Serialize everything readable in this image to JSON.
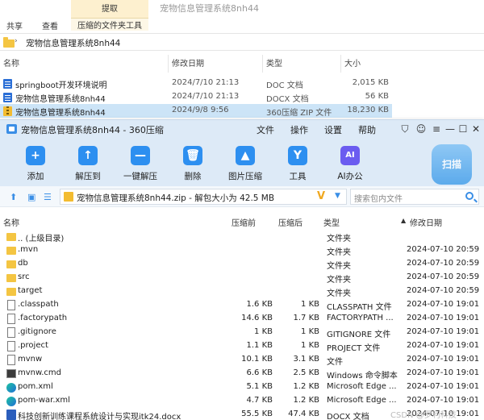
{
  "explorer": {
    "tabs": [
      "共享",
      "查看"
    ],
    "tool_group_title": "提取",
    "tool_group_tab": "压缩的文件夹工具",
    "window_title": "宠物信息管理系统8nh44",
    "address": "宠物信息管理系统8nh44",
    "columns": [
      "名称",
      "修改日期",
      "类型",
      "大小"
    ],
    "files": [
      {
        "name": "springboot开发环境说明",
        "date": "2024/7/10 21:13",
        "type": "DOC 文档",
        "size": "2,015 KB",
        "icon": "doc-icon",
        "selected": false
      },
      {
        "name": "宠物信息管理系统8nh44",
        "date": "2024/7/10 21:13",
        "type": "DOCX 文档",
        "size": "56 KB",
        "icon": "doc-icon",
        "selected": false
      },
      {
        "name": "宠物信息管理系统8nh44",
        "date": "2024/9/8 9:56",
        "type": "360压缩 ZIP 文件",
        "size": "18,230 KB",
        "icon": "zip-icon",
        "selected": true
      }
    ]
  },
  "app": {
    "title": "宠物信息管理系统8nh44 - 360压缩",
    "menu": [
      "文件",
      "操作",
      "设置",
      "帮助"
    ],
    "toolbar": [
      {
        "label": "添加",
        "icon": "add-icon",
        "glyph": "+"
      },
      {
        "label": "解压到",
        "icon": "extract-to-icon",
        "glyph": "↑"
      },
      {
        "label": "一键解压",
        "icon": "one-click-extract-icon",
        "glyph": "—"
      },
      {
        "label": "删除",
        "icon": "delete-icon",
        "glyph": "🗑"
      },
      {
        "label": "图片压缩",
        "icon": "image-compress-icon",
        "glyph": "▲"
      },
      {
        "label": "工具",
        "icon": "tools-icon",
        "glyph": "Y"
      },
      {
        "label": "AI办公",
        "icon": "ai-office-icon",
        "glyph": "AI"
      }
    ],
    "scan_label": "扫描",
    "path": "宠物信息管理系统8nh44.zip - 解包大小为 42.5 MB",
    "search_placeholder": "搜索包内文件",
    "columns": [
      "名称",
      "压缩前",
      "压缩后",
      "类型",
      "修改日期"
    ],
    "rows": [
      {
        "name": ".. (上级目录)",
        "before": "",
        "after": "",
        "type": "文件夹",
        "date": "",
        "icon": "folder"
      },
      {
        "name": ".mvn",
        "before": "",
        "after": "",
        "type": "文件夹",
        "date": "2024-07-10 20:59",
        "icon": "folder"
      },
      {
        "name": "db",
        "before": "",
        "after": "",
        "type": "文件夹",
        "date": "2024-07-10 20:59",
        "icon": "folder"
      },
      {
        "name": "src",
        "before": "",
        "after": "",
        "type": "文件夹",
        "date": "2024-07-10 20:59",
        "icon": "folder"
      },
      {
        "name": "target",
        "before": "",
        "after": "",
        "type": "文件夹",
        "date": "2024-07-10 20:59",
        "icon": "folder"
      },
      {
        "name": ".classpath",
        "before": "1.6 KB",
        "after": "1 KB",
        "type": "CLASSPATH 文件",
        "date": "2024-07-10 19:01",
        "icon": "file"
      },
      {
        "name": ".factorypath",
        "before": "14.6 KB",
        "after": "1.7 KB",
        "type": "FACTORYPATH ...",
        "date": "2024-07-10 19:01",
        "icon": "file"
      },
      {
        "name": ".gitignore",
        "before": "1 KB",
        "after": "1 KB",
        "type": "GITIGNORE 文件",
        "date": "2024-07-10 19:01",
        "icon": "file"
      },
      {
        "name": ".project",
        "before": "1.1 KB",
        "after": "1 KB",
        "type": "PROJECT 文件",
        "date": "2024-07-10 19:01",
        "icon": "file"
      },
      {
        "name": "mvnw",
        "before": "10.1 KB",
        "after": "3.1 KB",
        "type": "文件",
        "date": "2024-07-10 19:01",
        "icon": "file"
      },
      {
        "name": "mvnw.cmd",
        "before": "6.6 KB",
        "after": "2.5 KB",
        "type": "Windows 命令脚本",
        "date": "2024-07-10 19:01",
        "icon": "cmd"
      },
      {
        "name": "pom.xml",
        "before": "5.1 KB",
        "after": "1.2 KB",
        "type": "Microsoft Edge ...",
        "date": "2024-07-10 19:01",
        "icon": "edge"
      },
      {
        "name": "pom-war.xml",
        "before": "4.7 KB",
        "after": "1.2 KB",
        "type": "Microsoft Edge ...",
        "date": "2024-07-10 19:01",
        "icon": "edge"
      },
      {
        "name": "科技创新训练课程系统设计与实现itk24.docx",
        "before": "55.5 KB",
        "after": "47.4 KB",
        "type": "DOCX 文档",
        "date": "2024-07-10 19:01",
        "icon": "word"
      }
    ],
    "watermark": "CSDN @罗利科技"
  }
}
